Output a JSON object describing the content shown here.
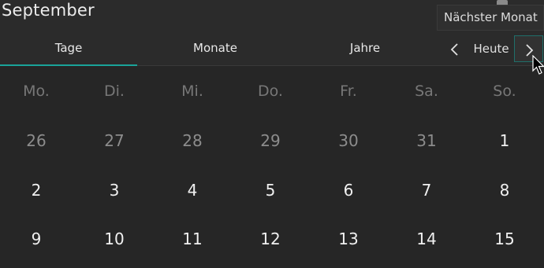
{
  "header": {
    "title": "September"
  },
  "tooltip": {
    "text": "Nächster Monat"
  },
  "tabs": [
    {
      "label": "Tage",
      "active": true
    },
    {
      "label": "Monate",
      "active": false
    },
    {
      "label": "Jahre",
      "active": false
    }
  ],
  "nav": {
    "prev_icon": "chevron-left-icon",
    "today_label": "Heute",
    "next_icon": "chevron-right-icon"
  },
  "weekdays": [
    "Mo.",
    "Di.",
    "Mi.",
    "Do.",
    "Fr.",
    "Sa.",
    "So."
  ],
  "weeks": [
    [
      {
        "day": "26",
        "outside_month": true
      },
      {
        "day": "27",
        "outside_month": true
      },
      {
        "day": "28",
        "outside_month": true
      },
      {
        "day": "29",
        "outside_month": true
      },
      {
        "day": "30",
        "outside_month": true
      },
      {
        "day": "31",
        "outside_month": true
      },
      {
        "day": "1",
        "outside_month": false
      }
    ],
    [
      {
        "day": "2",
        "outside_month": false
      },
      {
        "day": "3",
        "outside_month": false
      },
      {
        "day": "4",
        "outside_month": false
      },
      {
        "day": "5",
        "outside_month": false
      },
      {
        "day": "6",
        "outside_month": false
      },
      {
        "day": "7",
        "outside_month": false
      },
      {
        "day": "8",
        "outside_month": false
      }
    ],
    [
      {
        "day": "9",
        "outside_month": false
      },
      {
        "day": "10",
        "outside_month": false
      },
      {
        "day": "11",
        "outside_month": false
      },
      {
        "day": "12",
        "outside_month": false
      },
      {
        "day": "13",
        "outside_month": false
      },
      {
        "day": "14",
        "outside_month": false
      },
      {
        "day": "15",
        "outside_month": false
      }
    ]
  ],
  "colors": {
    "background": "#262626",
    "accent": "#1aa39a",
    "muted_text": "#8c8c8c"
  }
}
